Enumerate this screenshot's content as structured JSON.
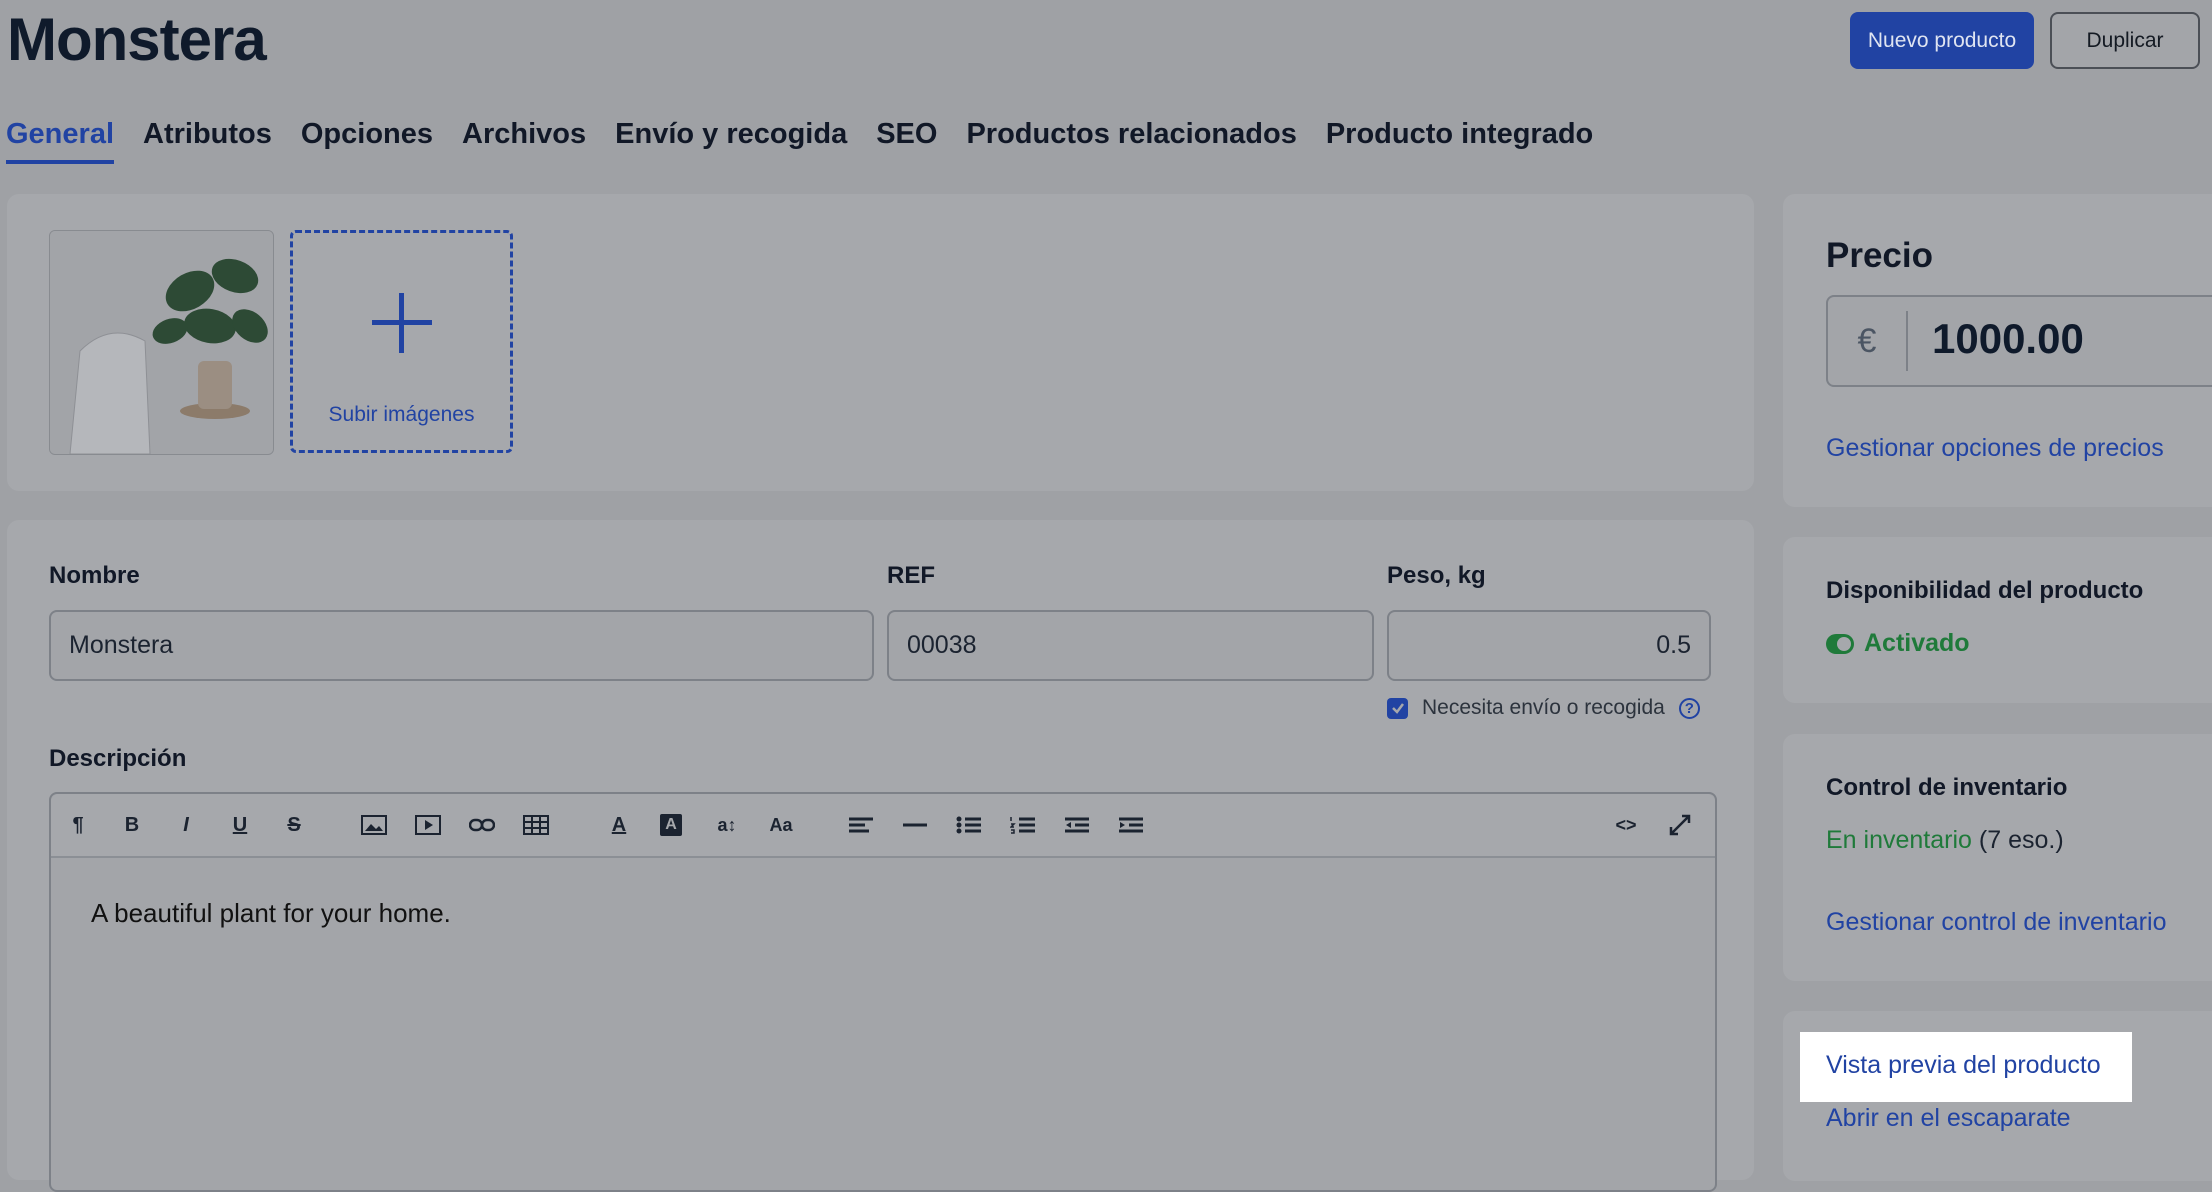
{
  "page": {
    "title": "Monstera"
  },
  "actions": {
    "new_product": "Nuevo producto",
    "duplicate": "Duplicar"
  },
  "tabs": [
    {
      "label": "General",
      "active": true
    },
    {
      "label": "Atributos"
    },
    {
      "label": "Opciones"
    },
    {
      "label": "Archivos"
    },
    {
      "label": "Envío y recogida"
    },
    {
      "label": "SEO"
    },
    {
      "label": "Productos relacionados"
    },
    {
      "label": "Producto integrado"
    }
  ],
  "images": {
    "upload_label": "Subir imágenes"
  },
  "fields": {
    "name": {
      "label": "Nombre",
      "value": "Monstera"
    },
    "ref": {
      "label": "REF",
      "value": "00038"
    },
    "weight": {
      "label": "Peso, kg",
      "value": "0.5"
    },
    "shipping_check": {
      "label": "Necesita envío o recogida",
      "checked": true
    },
    "description": {
      "label": "Descripción",
      "value": "A beautiful plant for your home."
    }
  },
  "price": {
    "title": "Precio",
    "currency": "€",
    "value": "1000.00",
    "manage_link": "Gestionar opciones de precios"
  },
  "availability": {
    "title": "Disponibilidad del producto",
    "status": "Activado"
  },
  "inventory": {
    "title": "Control de inventario",
    "status": "En inventario",
    "count": "(7 eso.)",
    "manage_link": "Gestionar control de inventario"
  },
  "links": {
    "preview": "Vista previa del producto",
    "storefront": "Abrir en el escaparate"
  },
  "colors": {
    "accent": "#2143a3",
    "success": "#1f7a3a",
    "overlay_bg": "#9fa1a5"
  }
}
